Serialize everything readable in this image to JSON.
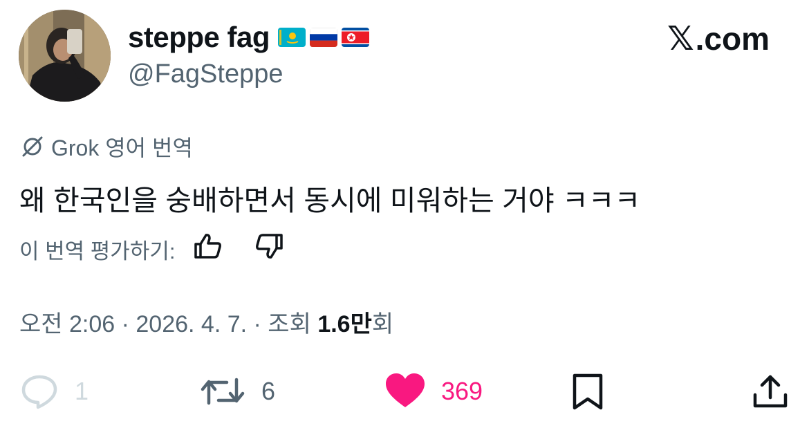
{
  "author": {
    "display_name": "steppe fag",
    "handle": "@FagSteppe",
    "flags": [
      "kazakhstan-flag",
      "russia-flag",
      "north-korea-flag"
    ]
  },
  "site": {
    "logo_text": ".com",
    "logo_mark": "𝕏"
  },
  "translation": {
    "label": "Grok 영어 번역",
    "text": "왜 한국인을 숭배하면서 동시에 미워하는 거야 ㅋㅋㅋ",
    "rate_label": "이 번역 평가하기:"
  },
  "meta": {
    "time_date": "오전 2:06 · 2026. 4. 7. · 조회 ",
    "views_count": "1.6만",
    "views_suffix": "회"
  },
  "actions": {
    "reply_count": "1",
    "retweet_count": "6",
    "like_count": "369"
  },
  "colors": {
    "text_primary": "#0f1419",
    "text_secondary": "#536471",
    "like_pink": "#f91880",
    "disabled": "#cfd9de"
  }
}
